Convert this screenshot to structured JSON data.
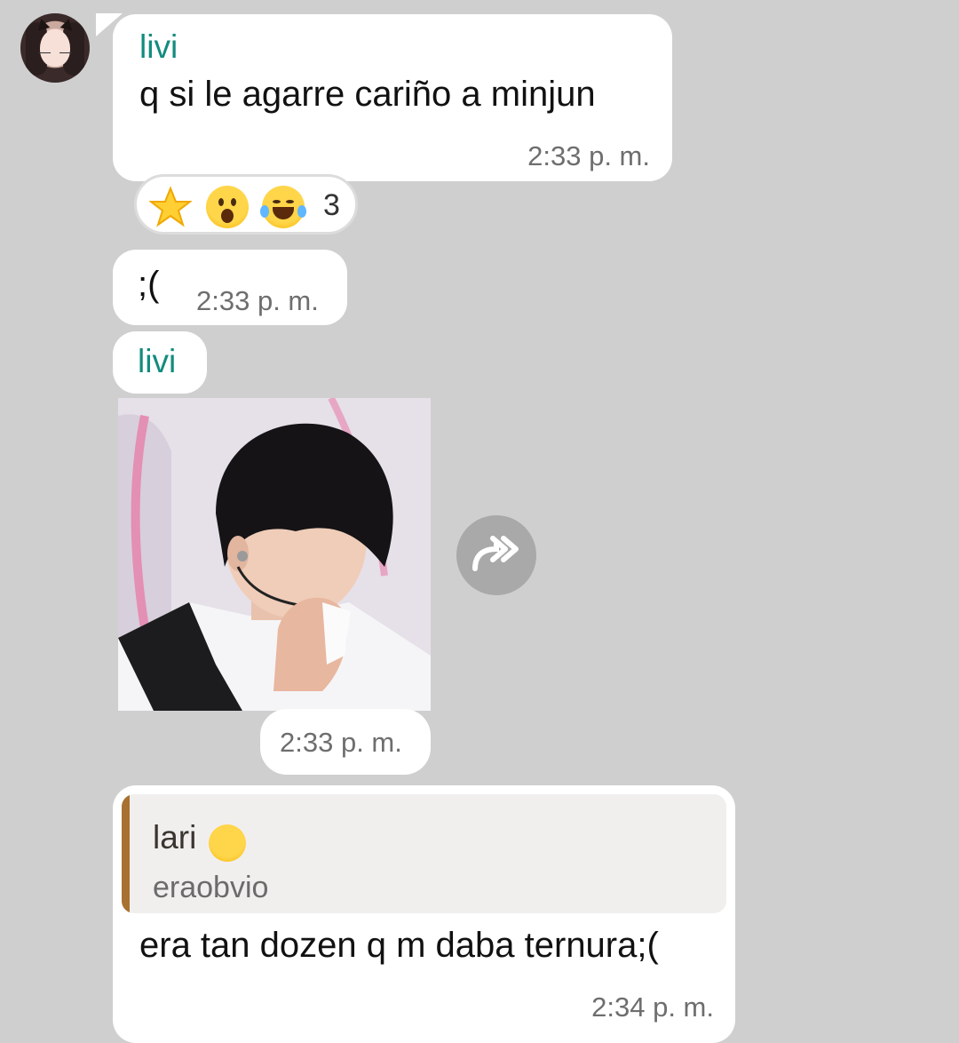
{
  "messages": [
    {
      "sender": "livi",
      "text": "q si le agarre cariño a minjun",
      "time": "2:33 p. m.",
      "reactions": {
        "emojis": [
          "star-emoji",
          "surprised-face-emoji",
          "tears-of-joy-emoji"
        ],
        "count": "3"
      }
    },
    {
      "text": ";(",
      "time": "2:33 p. m."
    },
    {
      "sender": "livi",
      "image": "photo of a person in a white shirt wiping face with tissue",
      "time": "2:33 p. m."
    },
    {
      "reply_to": {
        "sender": "lari",
        "text": "eraobvio"
      },
      "text": "era tan dozen q m daba ternura;(",
      "time": "2:34 p. m."
    }
  ],
  "colors": {
    "background": "#cfcfcf",
    "bubble": "#ffffff",
    "sender_name": "#128c7e",
    "quote_bar": "#a87131",
    "forward_button": "#a9a9a9"
  }
}
